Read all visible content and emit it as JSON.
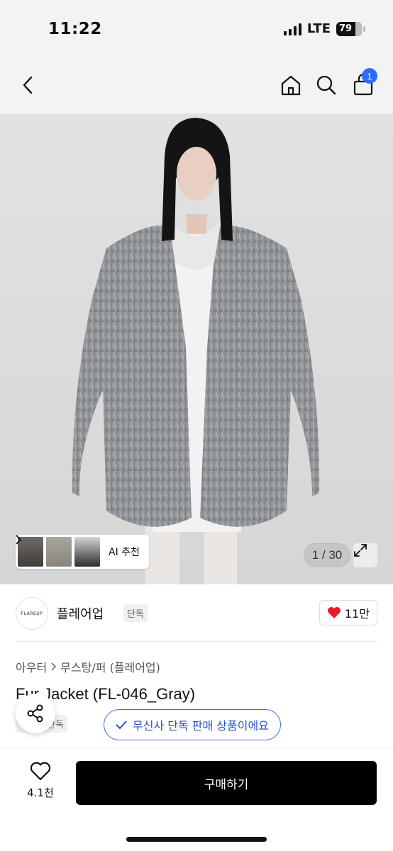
{
  "status_bar": {
    "time": "11:22",
    "network": "LTE",
    "battery": "79"
  },
  "nav": {
    "cart_count": "1"
  },
  "gallery": {
    "ai_label": "AI 추천",
    "counter": "1 / 30"
  },
  "brand": {
    "name": "플레어업",
    "logo_text": "FLAREUP",
    "tag": "단독",
    "likes": "11만"
  },
  "breadcrumb": {
    "level1": "아우터",
    "level2": "무스탕/퍼 (플레어업)"
  },
  "product": {
    "title": "Fur Jacket (FL-046_Gray)",
    "tag": "단독",
    "exclusive_label": "무신사 단독 판매 상품이에요"
  },
  "bottom_bar": {
    "wish_count": "4.1천",
    "buy_label": "구매하기"
  },
  "colors": {
    "accent_blue": "#2f6bff",
    "pill_blue": "#2752c9",
    "heart_red": "#e3202b"
  }
}
